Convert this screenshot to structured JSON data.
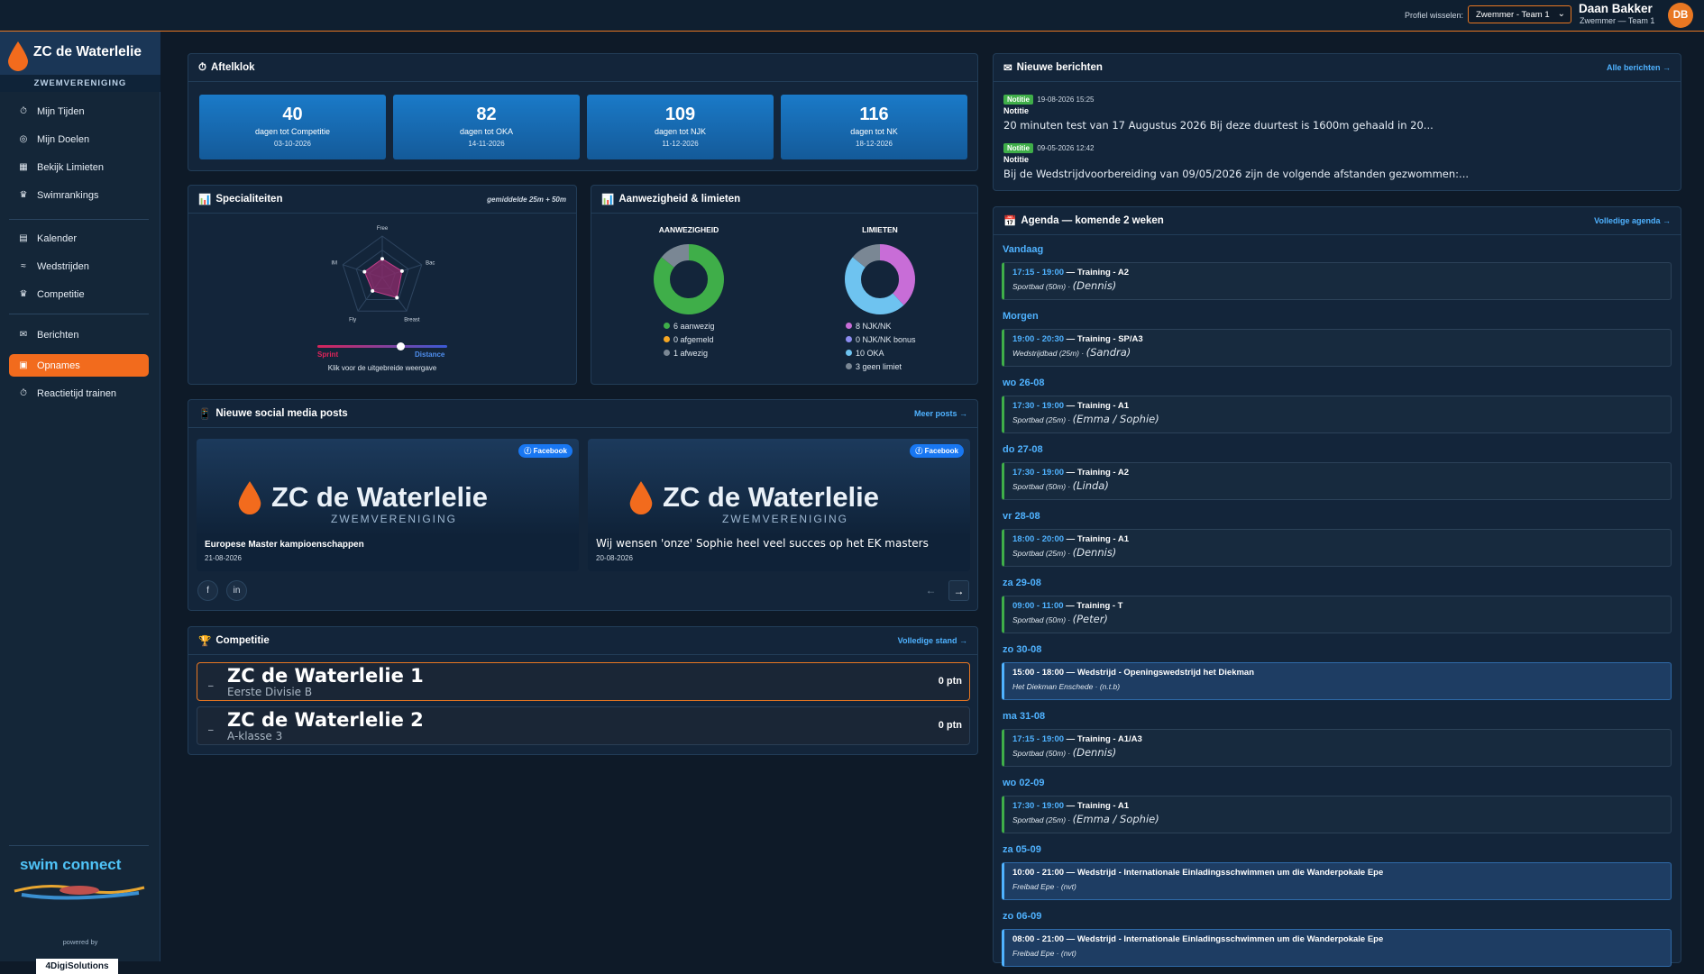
{
  "topbar": {
    "profile_label": "Profiel wisselen:",
    "profile_select": "Zwemmer - Team 1",
    "user_name": "Daan Bakker",
    "user_role": "Zwemmer — Team 1",
    "avatar": "DB"
  },
  "sidebar": {
    "club_name": "ZC de Waterlelie",
    "club_sub": "ZWEMVERENIGING",
    "items": [
      {
        "label": "Mijn Tijden",
        "icon": "timer-icon"
      },
      {
        "label": "Mijn Doelen",
        "icon": "target-icon"
      },
      {
        "label": "Bekijk Limieten",
        "icon": "chart-icon"
      },
      {
        "label": "Swimrankings",
        "icon": "trophy-icon"
      },
      {
        "label": "Kalender",
        "icon": "calendar-icon"
      },
      {
        "label": "Wedstrijden",
        "icon": "swim-icon"
      },
      {
        "label": "Competitie",
        "icon": "trophy-icon"
      },
      {
        "label": "Berichten",
        "icon": "mail-icon"
      },
      {
        "label": "Opnames",
        "icon": "camera-icon",
        "active": true
      },
      {
        "label": "Reactietijd trainen",
        "icon": "timer-icon"
      }
    ],
    "swim_connect": "swim connect",
    "powered_by": "powered by",
    "digi": "4DigiSolutions"
  },
  "countdown": {
    "title": "Aftelklok",
    "items": [
      {
        "num": "40",
        "label": "dagen tot Competitie",
        "date": "03-10-2026"
      },
      {
        "num": "82",
        "label": "dagen tot OKA",
        "date": "14-11-2026"
      },
      {
        "num": "109",
        "label": "dagen tot NJK",
        "date": "11-12-2026"
      },
      {
        "num": "116",
        "label": "dagen tot NK",
        "date": "18-12-2026"
      }
    ]
  },
  "specialities": {
    "title": "Specialiteiten",
    "note": "gemiddelde 25m + 50m",
    "axes": [
      "Free",
      "Bac",
      "Breast",
      "Fly",
      "IM"
    ],
    "values": [
      0.45,
      0.5,
      0.6,
      0.4,
      0.45
    ],
    "sprint": "Sprint",
    "distance": "Distance",
    "hint": "Klik voor de uitgebreide weergave"
  },
  "attendance": {
    "title": "Aanwezigheid & limieten",
    "att_title": "AANWEZIGHEID",
    "lim_title": "LIMIETEN",
    "att_legend": [
      {
        "label": "6 aanwezig",
        "color": "#3fae49",
        "value": 6
      },
      {
        "label": "0 afgemeld",
        "color": "#f5a623",
        "value": 0
      },
      {
        "label": "1 afwezig",
        "color": "#7a8794",
        "value": 1
      }
    ],
    "lim_legend": [
      {
        "label": "8 NJK/NK",
        "color": "#c86dd7",
        "value": 8
      },
      {
        "label": "0 NJK/NK bonus",
        "color": "#8c8cf0",
        "value": 0
      },
      {
        "label": "10 OKA",
        "color": "#6ec3f0",
        "value": 10
      },
      {
        "label": "3 geen limiet",
        "color": "#7a8794",
        "value": 3
      }
    ]
  },
  "social": {
    "title": "Nieuwe social media posts",
    "more": "Meer posts →",
    "badge": "Facebook",
    "logo_name": "ZC de Waterlelie",
    "logo_sub": "ZWEMVERENIGING",
    "posts": [
      {
        "caption": "Europese Master kampioenschappen",
        "date": "21-08-2026"
      },
      {
        "caption": "Wij wensen 'onze' Sophie heel veel succes op het EK masters",
        "date": "20-08-2026"
      }
    ],
    "prev": "←",
    "next": "→"
  },
  "competition": {
    "title": "Competitie",
    "link": "Volledige stand →",
    "teams": [
      {
        "name": "ZC de Waterlelie 1",
        "league": "Eerste Divisie B",
        "points": "0 ptn"
      },
      {
        "name": "ZC de Waterlelie 2",
        "league": "A-klasse 3",
        "points": "0 ptn"
      }
    ]
  },
  "messages": {
    "title": "Nieuwe berichten",
    "link": "Alle berichten →",
    "items": [
      {
        "badge": "Notitie",
        "datetime": "19-08-2026 15:25",
        "type": "Notitie",
        "text": "20 minuten test van 17 Augustus 2026 Bij deze duurtest is 1600m gehaald in 20..."
      },
      {
        "badge": "Notitie",
        "datetime": "09-05-2026 12:42",
        "type": "Notitie",
        "text": "Bij de Wedstrijdvoorbereiding van 09/05/2026 zijn de volgende afstanden gezwommen:..."
      }
    ]
  },
  "agenda": {
    "title": "Agenda — komende 2 weken",
    "link": "Volledige agenda →",
    "days": [
      {
        "day": "Vandaag",
        "event": {
          "time": "17:15 - 19:00",
          "title": " — Training - A2",
          "place": "Sportbad (50m) · ",
          "coach": "(Dennis)",
          "match": false
        }
      },
      {
        "day": "Morgen",
        "event": {
          "time": "19:00 - 20:30",
          "title": " — Training - SP/A3",
          "place": "Wedstrijdbad (25m) · ",
          "coach": "(Sandra)",
          "match": false
        }
      },
      {
        "day": "wo 26-08",
        "event": {
          "time": "17:30 - 19:00",
          "title": " — Training - A1",
          "place": "Sportbad (25m) · ",
          "coach": "(Emma / Sophie)",
          "match": false
        }
      },
      {
        "day": "do 27-08",
        "event": {
          "time": "17:30 - 19:00",
          "title": " — Training - A2",
          "place": "Sportbad (50m) · ",
          "coach": "(Linda)",
          "match": false
        }
      },
      {
        "day": "vr 28-08",
        "event": {
          "time": "18:00 - 20:00",
          "title": " — Training - A1",
          "place": "Sportbad (25m) · ",
          "coach": "(Dennis)",
          "match": false
        }
      },
      {
        "day": "za 29-08",
        "event": {
          "time": "09:00 - 11:00",
          "title": " — Training - T",
          "place": "Sportbad (50m) · ",
          "coach": "(Peter)",
          "match": false
        }
      },
      {
        "day": "zo 30-08",
        "event": {
          "time": "15:00 - 18:00",
          "title": " — Wedstrijd - Openingswedstrijd het Diekman",
          "place": "Het Diekman Enschede · (n.t.b)",
          "coach": "",
          "match": true
        }
      },
      {
        "day": "ma 31-08",
        "event": {
          "time": "17:15 - 19:00",
          "title": " — Training - A1/A3",
          "place": "Sportbad (50m) · ",
          "coach": "(Dennis)",
          "match": false
        }
      },
      {
        "day": "wo 02-09",
        "event": {
          "time": "17:30 - 19:00",
          "title": " — Training - A1",
          "place": "Sportbad (25m) · ",
          "coach": "(Emma / Sophie)",
          "match": false
        }
      },
      {
        "day": "za 05-09",
        "event": {
          "time": "10:00 - 21:00",
          "title": " — Wedstrijd - Internationale Einladingsschwimmen um die Wanderpokale Epe",
          "place": "Freibad Epe · (nvt)",
          "coach": "",
          "match": true
        }
      },
      {
        "day": "zo 06-09",
        "event": {
          "time": "08:00 - 21:00",
          "title": " — Wedstrijd - Internationale Einladingsschwimmen um die Wanderpokale Epe",
          "place": "Freibad Epe · (nvt)",
          "coach": "",
          "match": true
        }
      }
    ]
  },
  "colors": {
    "accent": "#f26b1d",
    "link": "#4fb2ff",
    "countdown": "#1a7ac8",
    "badge": "#3fae49"
  }
}
